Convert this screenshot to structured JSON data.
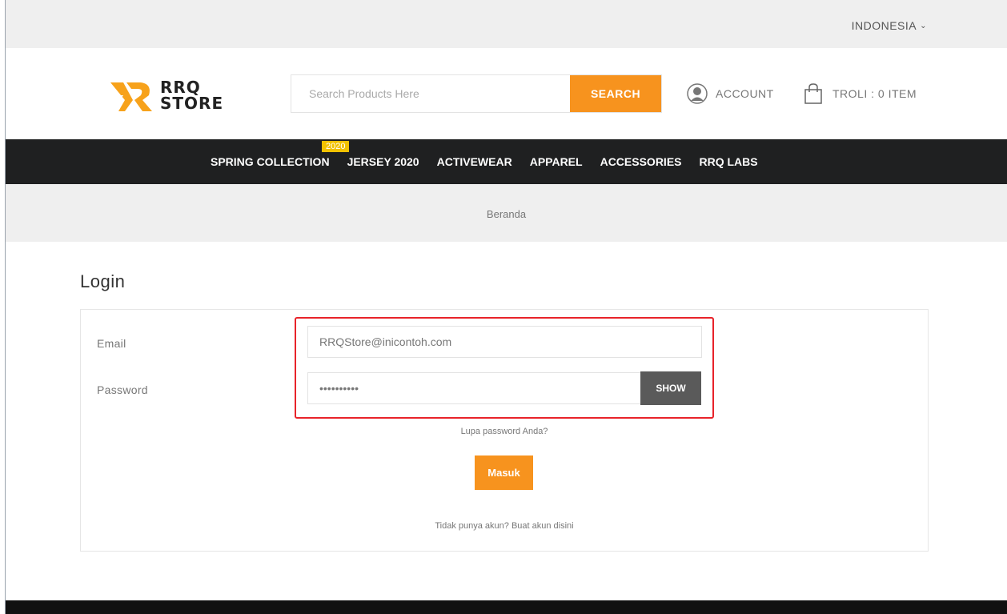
{
  "topbar": {
    "language": "INDONESIA"
  },
  "header": {
    "logo": {
      "line1": "RRQ",
      "line2": "STORE"
    },
    "search": {
      "placeholder": "Search Products Here",
      "button_label": "SEARCH"
    },
    "account_label": "ACCOUNT",
    "cart_label": "TROLI : 0 ITEM"
  },
  "nav": {
    "items": [
      {
        "label": "SPRING COLLECTION"
      },
      {
        "label": "JERSEY 2020",
        "badge": "2020"
      },
      {
        "label": "ACTIVEWEAR"
      },
      {
        "label": "APPAREL"
      },
      {
        "label": "ACCESSORIES"
      },
      {
        "label": "RRQ LABS"
      }
    ]
  },
  "breadcrumb": {
    "label": "Beranda"
  },
  "login": {
    "title": "Login",
    "email_label": "Email",
    "email_value": "RRQStore@inicontoh.com",
    "password_label": "Password",
    "password_value": "••••••••••",
    "show_label": "SHOW",
    "forgot_label": "Lupa password Anda?",
    "submit_label": "Masuk",
    "register_label": "Tidak punya akun? Buat akun disini"
  },
  "colors": {
    "accent": "#f7931e",
    "navbar": "#1f2021",
    "badge": "#f2c200",
    "highlight": "#e8232a"
  }
}
